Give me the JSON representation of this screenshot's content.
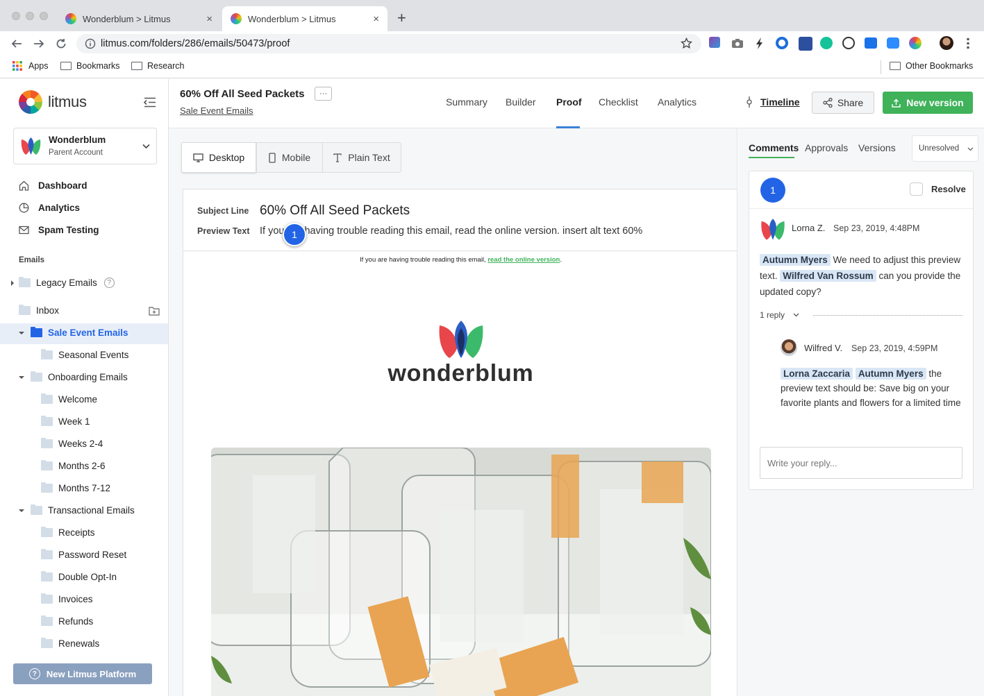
{
  "browser": {
    "tabs": [
      {
        "title": "Wonderblum > Litmus",
        "close": "×"
      },
      {
        "title": "Wonderblum > Litmus",
        "close": "×"
      }
    ],
    "new_tab": "+",
    "url": "litmus.com/folders/286/emails/50473/proof",
    "bookmarks": [
      {
        "label": "Apps"
      },
      {
        "label": "Bookmarks"
      },
      {
        "label": "Research"
      }
    ],
    "other_bookmarks": "Other Bookmarks"
  },
  "sidebar": {
    "logo_text": "litmus",
    "account_name": "Wonderblum",
    "account_sub": "Parent Account",
    "nav": [
      {
        "label": "Dashboard",
        "icon": "home-icon"
      },
      {
        "label": "Analytics",
        "icon": "pie-chart-icon"
      },
      {
        "label": "Spam Testing",
        "icon": "mail-icon"
      }
    ],
    "emails_heading": "Emails",
    "legacy": "Legacy Emails",
    "help_glyph": "?",
    "inbox": "Inbox",
    "tree": [
      {
        "label": "Sale Event Emails",
        "level": 0,
        "expanded": true,
        "active": true
      },
      {
        "label": "Seasonal Events",
        "level": 1
      },
      {
        "label": "Onboarding Emails",
        "level": 0,
        "expanded": true
      },
      {
        "label": "Welcome",
        "level": 1
      },
      {
        "label": "Week 1",
        "level": 1
      },
      {
        "label": "Weeks 2-4",
        "level": 1
      },
      {
        "label": "Months 2-6",
        "level": 1
      },
      {
        "label": "Months 7-12",
        "level": 1
      },
      {
        "label": "Transactional Emails",
        "level": 0,
        "expanded": true
      },
      {
        "label": "Receipts",
        "level": 1
      },
      {
        "label": "Password Reset",
        "level": 1
      },
      {
        "label": "Double Opt-In",
        "level": 1
      },
      {
        "label": "Invoices",
        "level": 1
      },
      {
        "label": "Refunds",
        "level": 1
      },
      {
        "label": "Renewals",
        "level": 1
      }
    ],
    "platform_button": "New Litmus Platform"
  },
  "header": {
    "title": "60% Off All Seed Packets",
    "more": "···",
    "folder_link": "Sale Event Emails",
    "tabs": [
      {
        "label": "Summary"
      },
      {
        "label": "Builder"
      },
      {
        "label": "Proof",
        "active": true
      },
      {
        "label": "Checklist"
      },
      {
        "label": "Analytics"
      }
    ],
    "timeline": "Timeline",
    "share": "Share",
    "new_version": "New version",
    "accent": "#3fb25a"
  },
  "proof": {
    "views": [
      {
        "label": "Desktop",
        "active": true
      },
      {
        "label": "Mobile"
      },
      {
        "label": "Plain Text"
      }
    ],
    "subject_label": "Subject Line",
    "subject_value": "60% Off All Seed Packets",
    "preview_label": "Preview Text",
    "preview_value": "If you are having trouble reading this email, read the online version. insert alt text 60%",
    "pin_number": "1",
    "email_top_text": "If you are having trouble reading this email,",
    "email_top_link": "read the online version",
    "email_top_end": ".",
    "brand_name": "wonderblum"
  },
  "comments": {
    "tabs": [
      {
        "label": "Comments",
        "active": true
      },
      {
        "label": "Approvals"
      },
      {
        "label": "Versions"
      }
    ],
    "filter": "Unresolved",
    "thread_number": "1",
    "resolve": "Resolve",
    "author": "Lorna Z.",
    "time": "Sep 23, 2019, 4:48PM",
    "body": {
      "mention1": "Autumn Myers",
      "text1": "We need to adjust this preview text.",
      "mention2": "Wilfred Van Rossum",
      "text2": "can you provide the updated copy?"
    },
    "replies_toggle": "1 reply",
    "reply": {
      "author": "Wilfred V.",
      "time": "Sep 23, 2019, 4:59PM",
      "mention1": "Lorna Zaccaria",
      "mention2": "Autumn Myers",
      "text": "the preview text should be: Save big on your favorite plants and flowers for a limited time"
    },
    "reply_placeholder": "Write your reply..."
  }
}
